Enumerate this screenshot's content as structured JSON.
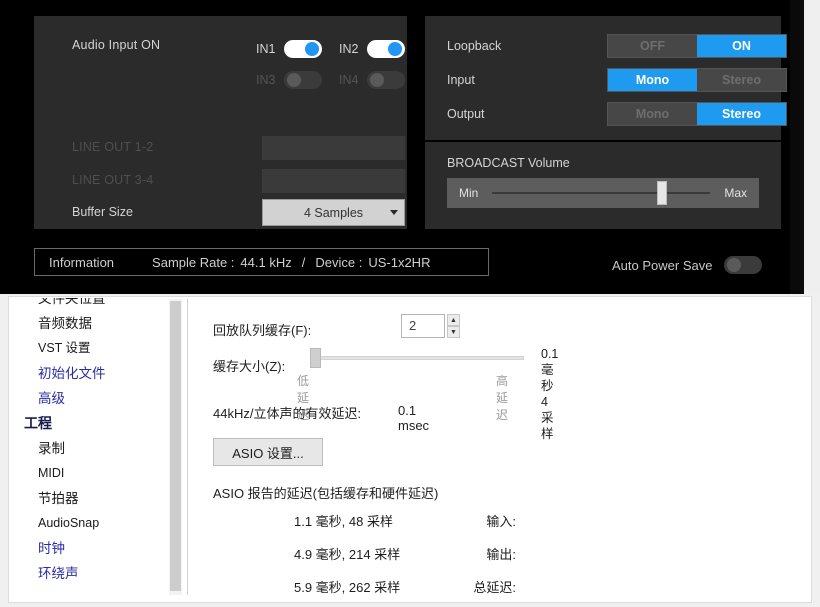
{
  "mixer": {
    "audio_input_label": "Audio Input ON",
    "inputs": [
      {
        "name": "IN1",
        "state": "on"
      },
      {
        "name": "IN2",
        "state": "on"
      },
      {
        "name": "IN3",
        "state": "off"
      },
      {
        "name": "IN4",
        "state": "off"
      }
    ],
    "line_out_12_label": "LINE OUT 1-2",
    "line_out_34_label": "LINE OUT 3-4",
    "buffer_size_label": "Buffer Size",
    "buffer_size_value": "4 Samples",
    "loopback_label": "Loopback",
    "loopback_off": "OFF",
    "loopback_on": "ON",
    "input_label": "Input",
    "input_mono": "Mono",
    "input_stereo": "Stereo",
    "output_label": "Output",
    "output_mono": "Mono",
    "output_stereo": "Stereo",
    "broadcast_title": "BROADCAST Volume",
    "broadcast_min": "Min",
    "broadcast_max": "Max",
    "broadcast_value_pct": 78,
    "information_label": "Information",
    "sample_rate_label": "Sample Rate :",
    "sample_rate_value": "44.1 kHz",
    "separator": "/",
    "device_label": "Device :",
    "device_value": "US-1x2HR",
    "auto_power_save_label": "Auto Power Save",
    "auto_power_save_state": "off",
    "accent_color": "#1e9bf0",
    "panel_color": "#2b2b2b"
  },
  "prefs": {
    "sidebar": [
      {
        "label": "文件夹位置",
        "style": "normal",
        "cut": true
      },
      {
        "label": "音频数据",
        "style": "normal"
      },
      {
        "label": "VST 设置",
        "style": "latin"
      },
      {
        "label": "初始化文件",
        "style": "blue"
      },
      {
        "label": "高级",
        "style": "blue"
      },
      {
        "label": "工程",
        "style": "head"
      },
      {
        "label": "录制",
        "style": "normal"
      },
      {
        "label": "MIDI",
        "style": "latin"
      },
      {
        "label": "节拍器",
        "style": "normal"
      },
      {
        "label": "AudioSnap",
        "style": "latin"
      },
      {
        "label": "时钟",
        "style": "blue"
      },
      {
        "label": "环绕声",
        "style": "blue"
      }
    ],
    "playback_queue_label": "回放队列缓存(F):",
    "playback_queue_value": "2",
    "spin_up": "▲",
    "spin_down": "▼",
    "buffer_size_label": "缓存大小(Z):",
    "buffer_slider_pct": 0,
    "latency_low": "低延迟",
    "latency_high": "高延迟",
    "buffer_msec": "0.1 毫秒",
    "buffer_samples": "4 采样",
    "effective_latency_label": "44kHz/立体声的有效延迟:",
    "effective_latency_value": "0.1 msec",
    "asio_settings_button": "ASIO 设置...",
    "asio_report_header": "ASIO 报告的延迟(包括缓存和硬件延迟)",
    "report": [
      {
        "key": "输入:",
        "value": "1.1 毫秒, 48 采样"
      },
      {
        "key": "输出:",
        "value": "4.9 毫秒, 214 采样"
      },
      {
        "key": "总延迟:",
        "value": "5.9 毫秒, 262 采样"
      }
    ]
  }
}
